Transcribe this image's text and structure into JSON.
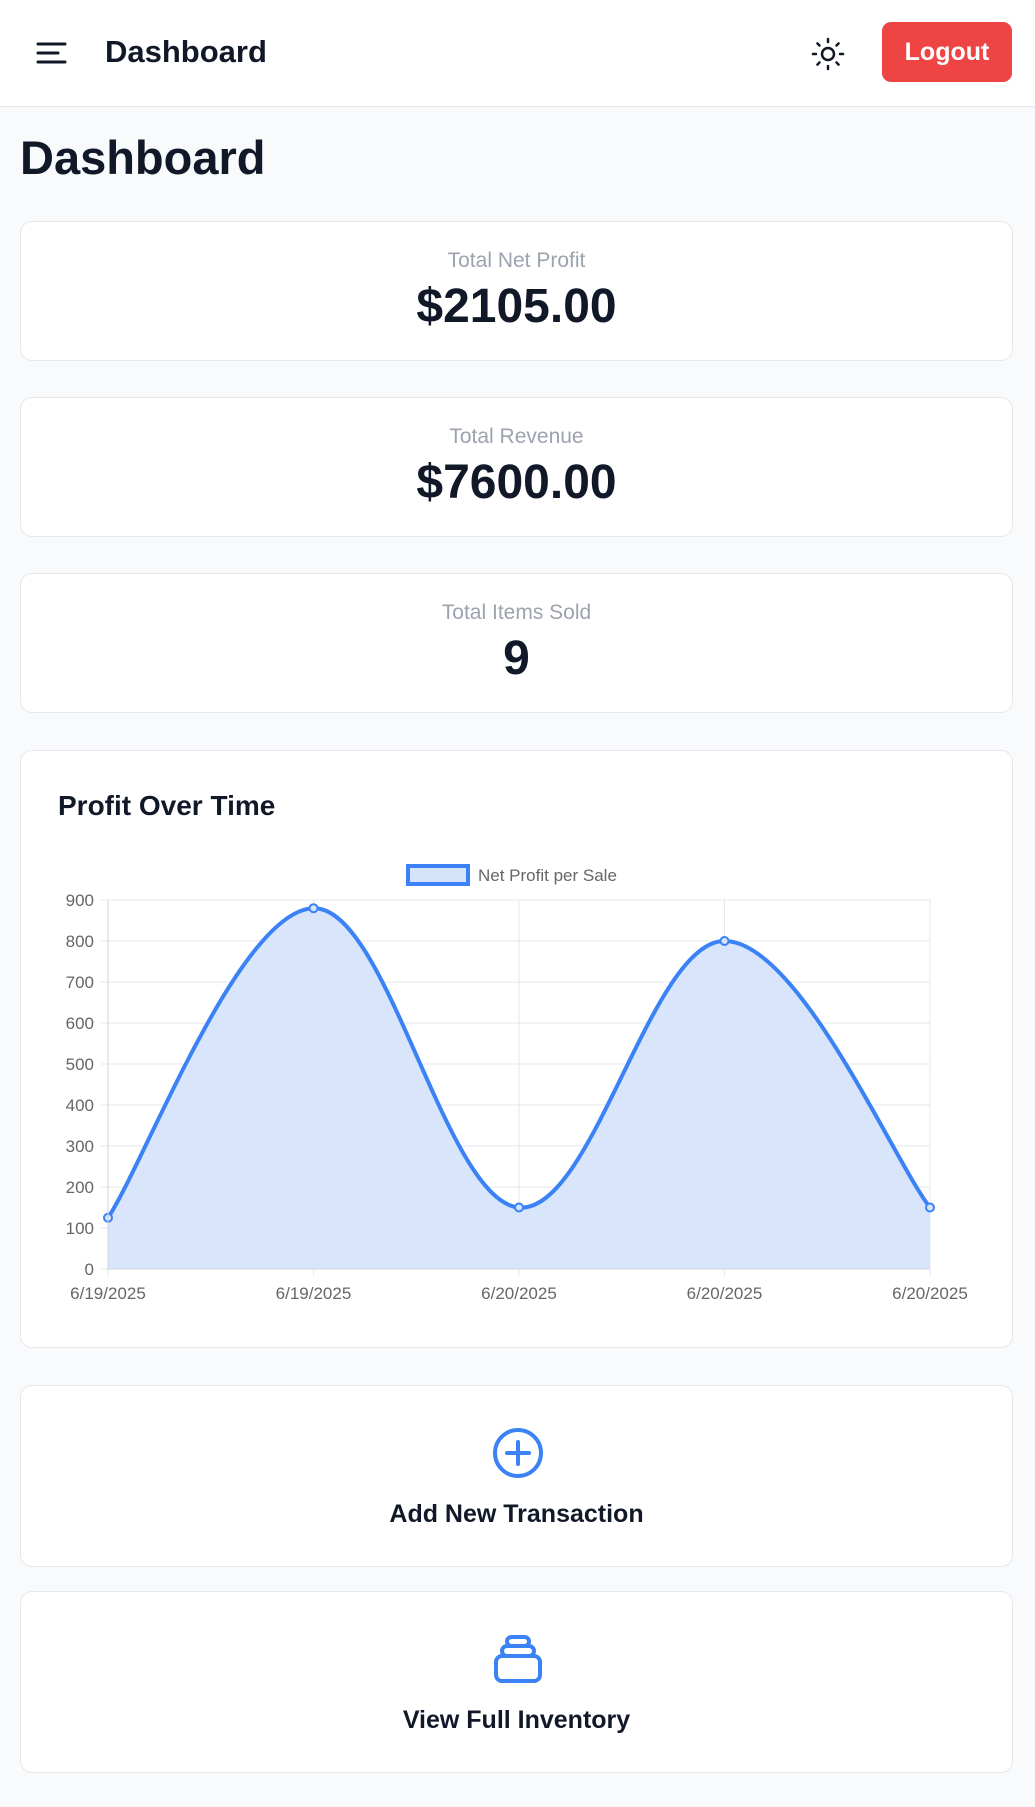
{
  "header": {
    "title": "Dashboard",
    "menu_icon": "hamburger-menu-icon",
    "theme_icon": "sun-icon",
    "logout_label": "Logout"
  },
  "page": {
    "title": "Dashboard"
  },
  "stats": [
    {
      "label": "Total Net Profit",
      "value": "$2105.00"
    },
    {
      "label": "Total Revenue",
      "value": "$7600.00"
    },
    {
      "label": "Total Items Sold",
      "value": "9"
    }
  ],
  "chart": {
    "title": "Profit Over Time"
  },
  "chart_data": {
    "type": "area",
    "x": [
      "6/19/2025",
      "6/19/2025",
      "6/20/2025",
      "6/20/2025",
      "6/20/2025"
    ],
    "series": [
      {
        "name": "Net Profit per Sale",
        "values": [
          125,
          880,
          150,
          800,
          150
        ]
      }
    ],
    "ylim": [
      0,
      900
    ],
    "yticks": [
      0,
      100,
      200,
      300,
      400,
      500,
      600,
      700,
      800,
      900
    ],
    "grid": true,
    "legend": "top-center",
    "line_color": "#3b82f6",
    "fill_color": "#d6e4fb"
  },
  "actions": [
    {
      "label": "Add New Transaction",
      "icon": "plus-circle-icon"
    },
    {
      "label": "View Full Inventory",
      "icon": "inventory-stack-icon"
    }
  ],
  "colors": {
    "accent": "#3b82f6",
    "danger": "#ef4444",
    "muted": "#9ca3af"
  }
}
